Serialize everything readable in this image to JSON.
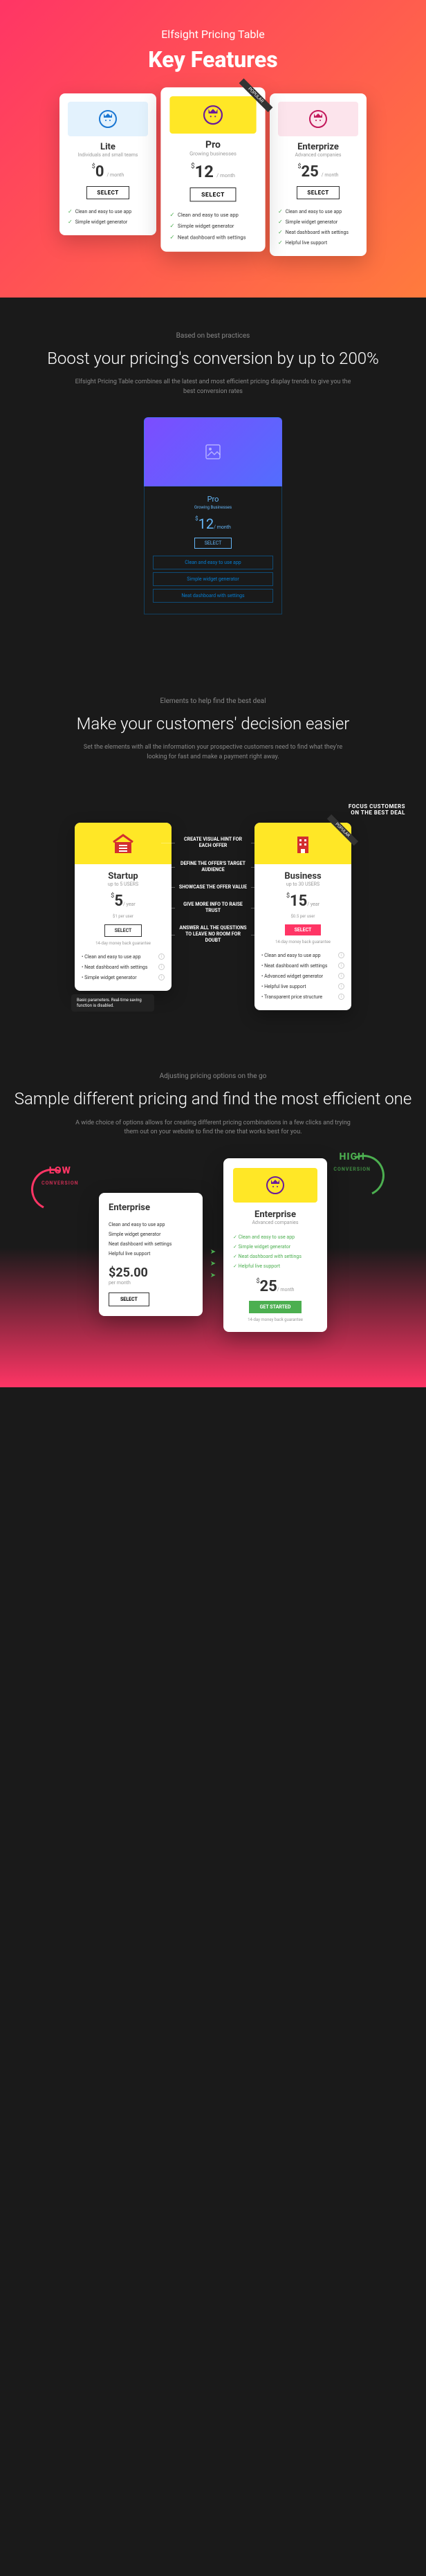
{
  "hero": {
    "subtitle": "Elfsight Pricing Table",
    "title": "Key Features",
    "ribbon": "POPULAR",
    "plans": [
      {
        "name": "Lite",
        "sub": "Individuals and small teams",
        "currency": "$",
        "amount": "0",
        "period": "/ month",
        "btn": "SELECT",
        "features": [
          "Clean and easy to use app",
          "Simple widget generator"
        ]
      },
      {
        "name": "Pro",
        "sub": "Growing businesses",
        "currency": "$",
        "amount": "12",
        "period": "/ month",
        "btn": "SELECT",
        "features": [
          "Clean and easy to use app",
          "Simple widget generator",
          "Neat dashboard with settings"
        ]
      },
      {
        "name": "Enterprize",
        "sub": "Advanced companies",
        "currency": "$",
        "amount": "25",
        "period": "/ month",
        "btn": "SELECT",
        "features": [
          "Clean and easy to use app",
          "Simple widget generator",
          "Neat dashboard with settings",
          "Helpful live support"
        ]
      }
    ]
  },
  "section1": {
    "eyebrow": "Based on best practices",
    "title": "Boost your pricing's conversion by up to 200%",
    "desc": "Elfsight Pricing Table combines all the latest and most efficient pricing display trends to give you the best conversion rates",
    "wire": {
      "name": "Pro",
      "sub": "Growing Businesses",
      "cur": "$",
      "amt": "12",
      "per": "/ month",
      "btn": "SELECT",
      "features": [
        "Clean and easy to use app",
        "Simple widget generator",
        "Neat dashboard with settings"
      ]
    }
  },
  "section2": {
    "eyebrow": "Elements to help find the best deal",
    "title": "Make your customers' decision easier",
    "desc": "Set the elements with all the information your prospective customers need to find what they're looking for fast and make a payment right away.",
    "focusHint": "FOCUS CUSTOMERS\nON THE BEST DEAL",
    "annotations": [
      "CREATE VISUAL HINT FOR EACH OFFER",
      "DEFINE THE OFFER'S TARGET AUDIENCE",
      "SHOWCASE THE OFFER VALUE",
      "GIVE MORE INFO TO RAISE TRUST",
      "ANSWER ALL THE QUESTIONS TO LEAVE NO ROOM FOR DOUBT"
    ],
    "ribbon": "POPULAR",
    "tooltip": "Basic parameters. Real-time saving function is disabled.",
    "plans": [
      {
        "name": "Startup",
        "sub": "up to 5 USERS",
        "cur": "$",
        "amt": "5",
        "per": "/ year",
        "unit": "$1 per user",
        "btn": "SELECT",
        "guarantee": "14-day money back guarantee",
        "features": [
          "Clean and easy to use app",
          "Neat dashboard with settings",
          "Simple widget generator"
        ]
      },
      {
        "name": "Business",
        "sub": "up to 30 USERS",
        "cur": "$",
        "amt": "15",
        "per": "/ year",
        "unit": "$0.5 per user",
        "btn": "SELECT",
        "guarantee": "14-day money back guarantee",
        "features": [
          "Clean and easy to use app",
          "Neat dashboard with settings",
          "Advanced widget generator",
          "Helpful live support",
          "Transparent price structure"
        ]
      }
    ]
  },
  "section3": {
    "eyebrow": "Adjusting pricing options on the go",
    "title": "Sample different pricing and find the most efficient one",
    "desc": "A wide choice of options allows for creating different pricing combinations in a few clicks and trying them out on your website to find the one that works best for you.",
    "low": {
      "label": "LOW",
      "sub": "CONVERSION",
      "name": "Enterprise",
      "features": [
        "Clean and easy to use app",
        "Simple widget generator",
        "Neat dashboard with settings",
        "Helpful live support"
      ],
      "price": "$25.00",
      "per": "per month",
      "btn": "SELECT"
    },
    "high": {
      "label": "HIGH",
      "sub": "CONVERSION",
      "name": "Enterprise",
      "csub": "Advanced companies",
      "features": [
        "Clean and easy to use app",
        "Simple widget generator",
        "Neat dashboard with settings",
        "Helpful live support"
      ],
      "cur": "$",
      "amt": "25",
      "per": "/ month",
      "btn": "GET STARTED",
      "note": "14-day money back guarantee"
    }
  }
}
